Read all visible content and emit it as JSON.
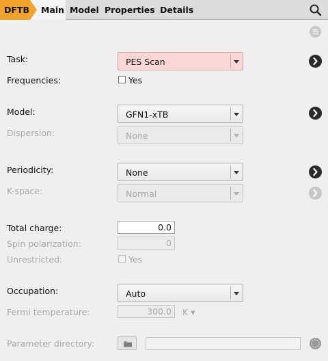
{
  "toolbar": {
    "engine_tab": "DFTB",
    "tabs": [
      "Main",
      "Model",
      "Properties",
      "Details"
    ]
  },
  "form": {
    "task": {
      "label": "Task:",
      "value": "PES Scan"
    },
    "frequencies": {
      "label": "Frequencies:",
      "checkbox_label": "Yes",
      "checked": false
    },
    "model": {
      "label": "Model:",
      "value": "GFN1-xTB"
    },
    "dispersion": {
      "label": "Dispersion:",
      "value": "None"
    },
    "periodicity": {
      "label": "Periodicity:",
      "value": "None"
    },
    "kspace": {
      "label": "K-space:",
      "value": "Normal"
    },
    "total_charge": {
      "label": "Total charge:",
      "value": "0.0"
    },
    "spin_polarization": {
      "label": "Spin polarization:",
      "value": "0"
    },
    "unrestricted": {
      "label": "Unrestricted:",
      "checkbox_label": "Yes",
      "checked": false
    },
    "occupation": {
      "label": "Occupation:",
      "value": "Auto"
    },
    "fermi_temperature": {
      "label": "Fermi temperature:",
      "value": "300.0",
      "unit": "K ▾"
    },
    "parameter_directory": {
      "label": "Parameter directory:",
      "value": ""
    }
  },
  "colors": {
    "accent": "#f2a32b",
    "task_highlight": "#fbd7d7"
  }
}
